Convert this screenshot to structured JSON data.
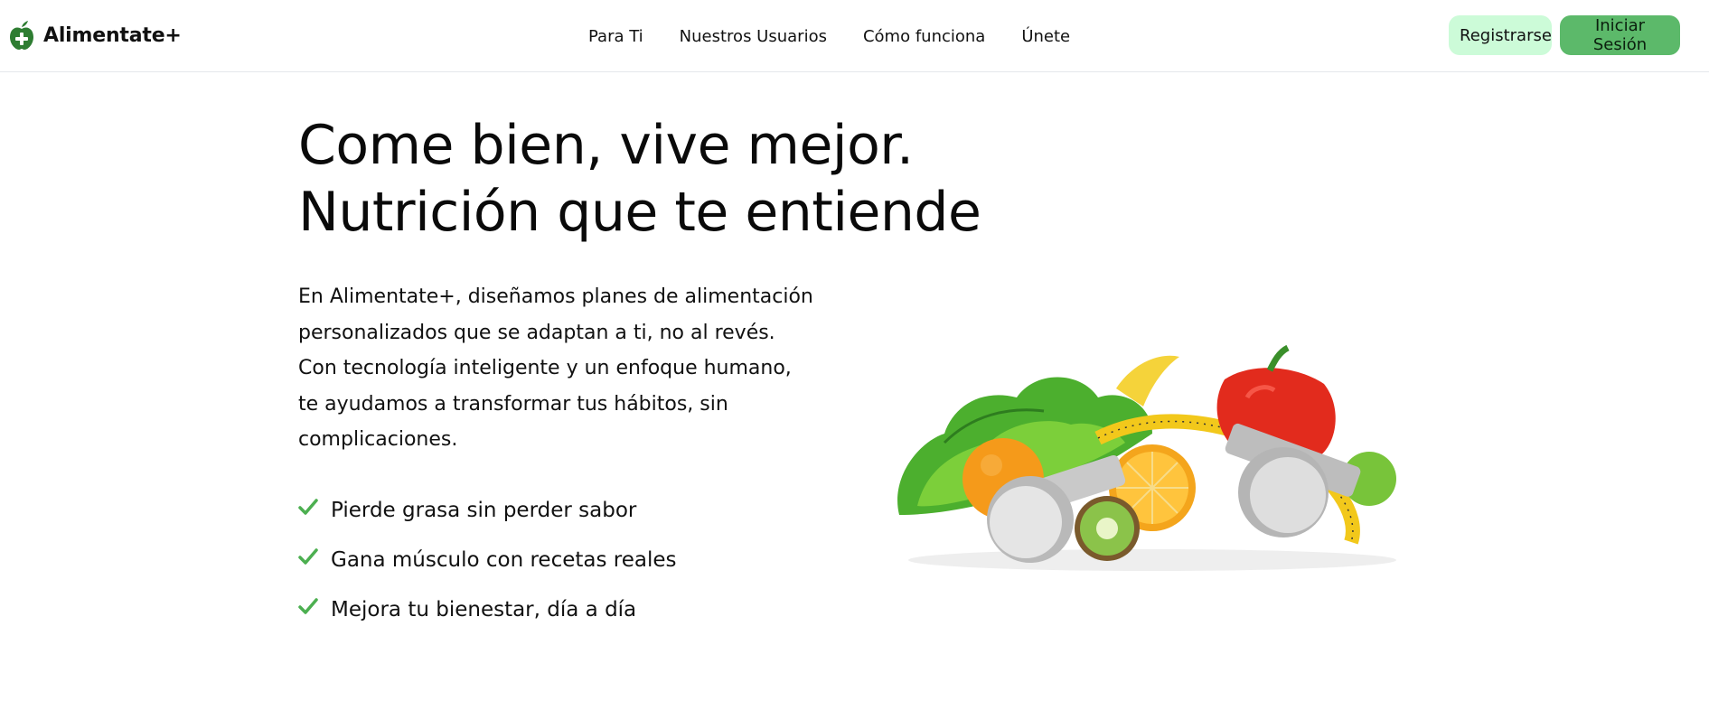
{
  "brand": {
    "name": "Alimentate+",
    "icon": "apple-plus-icon",
    "accent": "#2e7d32"
  },
  "nav": {
    "items": [
      {
        "label": "Para Ti"
      },
      {
        "label": "Nuestros Usuarios"
      },
      {
        "label": "Cómo funciona"
      },
      {
        "label": "Únete"
      }
    ]
  },
  "auth": {
    "register_label": "Registrarse",
    "login_label": "Iniciar Sesión",
    "register_color": "#ccfbd8",
    "login_color": "#5cb96a"
  },
  "hero": {
    "title_line1": "Come bien, vive mejor.",
    "title_line2": "Nutrición que te entiende",
    "description": "En Alimentate+, diseñamos planes de alimentación personalizados que se adaptan a ti, no al revés. Con tecnología inteligente y un enfoque humano, te ayudamos a transformar tus hábitos, sin complicaciones.",
    "benefits": [
      {
        "icon": "check-icon",
        "text": "Pierde grasa sin perder sabor"
      },
      {
        "icon": "check-icon",
        "text": "Gana músculo con recetas reales"
      },
      {
        "icon": "check-icon",
        "text": "Mejora tu bienestar, día a día"
      }
    ],
    "check_color": "#4caf50",
    "illustration": "fruit-vegetables-dumbbells-measuring-tape-image"
  }
}
